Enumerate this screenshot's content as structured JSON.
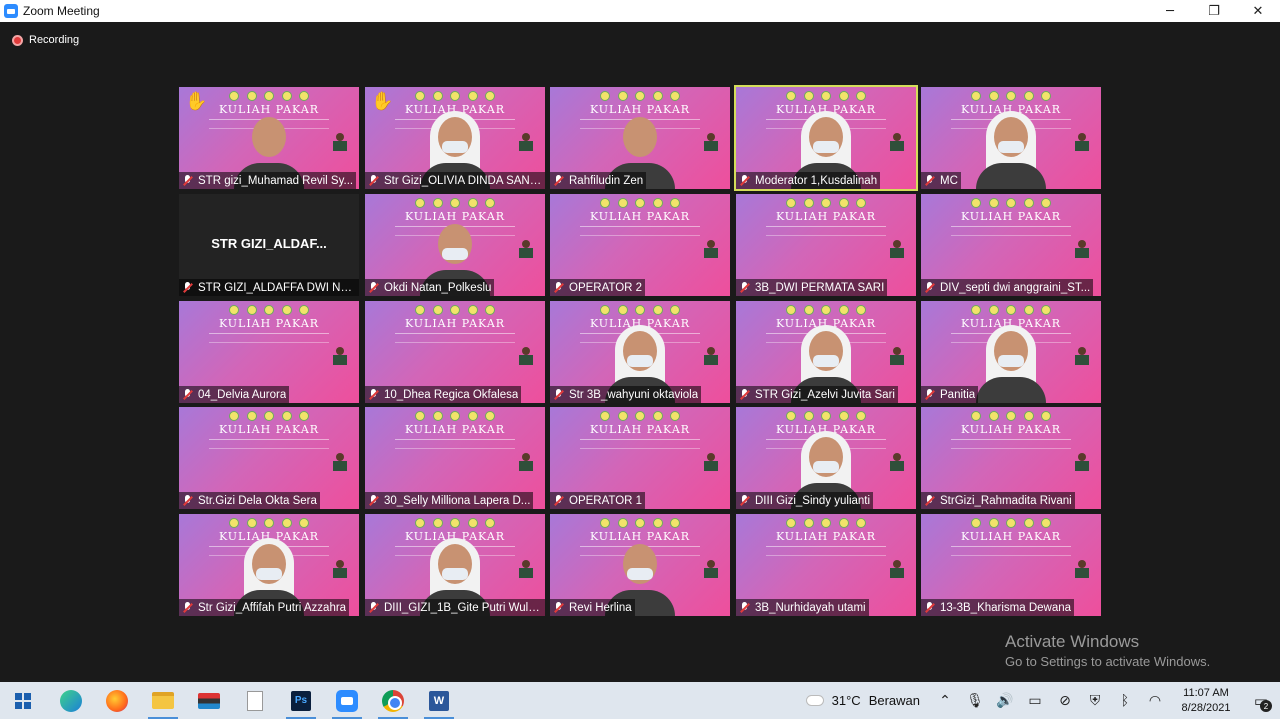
{
  "window": {
    "title": "Zoom Meeting",
    "minimize": "─",
    "maximize": "❐",
    "close": "✕"
  },
  "meeting": {
    "recording_label": "Recording"
  },
  "participants": [
    {
      "name": "STR gizi_Muhamad Revil Sy...",
      "muted": true,
      "hand_raised": true
    },
    {
      "name": "Str Gizi_OLIVIA DINDA SANTIKA",
      "muted": false,
      "hand_raised": true
    },
    {
      "name": "Rahfiludin Zen",
      "muted": false,
      "hand_raised": false
    },
    {
      "name": "Moderator 1,Kusdalinah",
      "muted": false,
      "hand_raised": false,
      "active_speaker": true
    },
    {
      "name": "MC",
      "muted": true,
      "hand_raised": false
    },
    {
      "name": "STR GIZI_ALDAFFA DWI NU...",
      "muted": true,
      "hand_raised": false,
      "video_off": true,
      "display_name": "STR GIZI_ALDAF..."
    },
    {
      "name": "Okdi Natan_Polkeslu",
      "muted": true,
      "hand_raised": false
    },
    {
      "name": "OPERATOR 2",
      "muted": true,
      "hand_raised": false
    },
    {
      "name": "3B_DWI PERMATA SARI",
      "muted": true,
      "hand_raised": false
    },
    {
      "name": "DIV_septi dwi anggraini_ST...",
      "muted": true,
      "hand_raised": false
    },
    {
      "name": "04_Delvia Aurora",
      "muted": true,
      "hand_raised": false
    },
    {
      "name": "10_Dhea Regica Okfalesa",
      "muted": true,
      "hand_raised": false
    },
    {
      "name": "Str 3B_wahyuni oktaviola",
      "muted": true,
      "hand_raised": false
    },
    {
      "name": "STR Gizi_Azelvi Juvita Sari",
      "muted": true,
      "hand_raised": false
    },
    {
      "name": "Panitia",
      "muted": true,
      "hand_raised": false
    },
    {
      "name": "Str.Gizi Dela Okta Sera",
      "muted": true,
      "hand_raised": false
    },
    {
      "name": "30_Selly Milliona Lapera D...",
      "muted": true,
      "hand_raised": false
    },
    {
      "name": "OPERATOR 1",
      "muted": true,
      "hand_raised": false
    },
    {
      "name": "DIII Gizi_Sindy yulianti",
      "muted": true,
      "hand_raised": false
    },
    {
      "name": "StrGizi_Rahmadita Rivani",
      "muted": true,
      "hand_raised": false
    },
    {
      "name": "Str Gizi_Affifah Putri Azzahra",
      "muted": true,
      "hand_raised": false
    },
    {
      "name": "DIII_GIZI_1B_Gite Putri Wula...",
      "muted": true,
      "hand_raised": false
    },
    {
      "name": "Revi Herlina",
      "muted": true,
      "hand_raised": false
    },
    {
      "name": "3B_Nurhidayah utami",
      "muted": true,
      "hand_raised": false
    },
    {
      "name": "13-3B_Kharisma Dewana",
      "muted": true,
      "hand_raised": false
    }
  ],
  "background_banner_text": "KULIAH PAKAR",
  "watermark": {
    "line1": "Activate Windows",
    "line2": "Go to Settings to activate Windows."
  },
  "taskbar": {
    "weather_temp": "31°C",
    "weather_condition": "Berawan",
    "time": "11:07 AM",
    "date": "8/28/2021",
    "notification_count": "2",
    "ps_label": "Ps",
    "word_label": "W"
  },
  "colors": {
    "active_speaker_border": "#d4de5a",
    "taskbar_bg": "#dfe6ee",
    "stage_bg": "#1a1a1a",
    "recording_dot": "#e03b3b"
  }
}
